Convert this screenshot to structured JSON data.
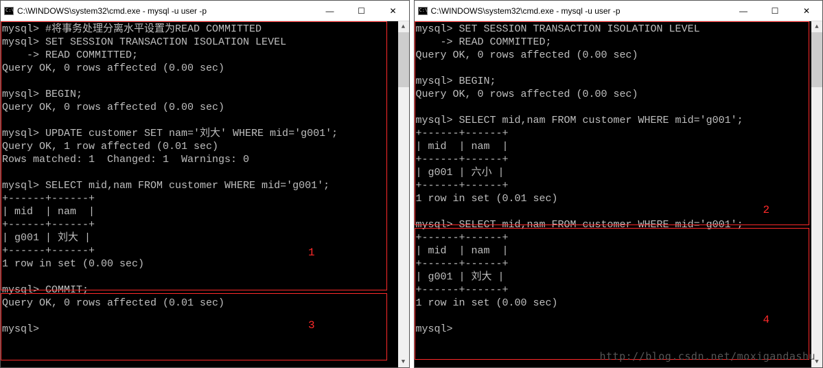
{
  "left": {
    "title": "C:\\WINDOWS\\system32\\cmd.exe - mysql  -u user -p",
    "lines": [
      "mysql> #将事务处理分离水平设置为READ COMMITTED",
      "mysql> SET SESSION TRANSACTION ISOLATION LEVEL",
      "    -> READ COMMITTED;",
      "Query OK, 0 rows affected (0.00 sec)",
      "",
      "mysql> BEGIN;",
      "Query OK, 0 rows affected (0.00 sec)",
      "",
      "mysql> UPDATE customer SET nam='刘大' WHERE mid='g001';",
      "Query OK, 1 row affected (0.01 sec)",
      "Rows matched: 1  Changed: 1  Warnings: 0",
      "",
      "mysql> SELECT mid,nam FROM customer WHERE mid='g001';",
      "+------+------+",
      "| mid  | nam  |",
      "+------+------+",
      "| g001 | 刘大 |",
      "+------+------+",
      "1 row in set (0.00 sec)",
      "",
      "mysql> COMMIT;",
      "Query OK, 0 rows affected (0.01 sec)",
      "",
      "mysql>"
    ],
    "box1_label": "1",
    "box3_label": "3"
  },
  "right": {
    "title": "C:\\WINDOWS\\system32\\cmd.exe - mysql  -u user -p",
    "lines": [
      "mysql> SET SESSION TRANSACTION ISOLATION LEVEL",
      "    -> READ COMMITTED;",
      "Query OK, 0 rows affected (0.00 sec)",
      "",
      "mysql> BEGIN;",
      "Query OK, 0 rows affected (0.00 sec)",
      "",
      "mysql> SELECT mid,nam FROM customer WHERE mid='g001';",
      "+------+------+",
      "| mid  | nam  |",
      "+------+------+",
      "| g001 | 六小 |",
      "+------+------+",
      "1 row in set (0.01 sec)",
      "",
      "mysql> SELECT mid,nam FROM customer WHERE mid='g001';",
      "+------+------+",
      "| mid  | nam  |",
      "+------+------+",
      "| g001 | 刘大 |",
      "+------+------+",
      "1 row in set (0.00 sec)",
      "",
      "mysql>"
    ],
    "box2_label": "2",
    "box4_label": "4"
  },
  "watermark": "http://blog.csdn.net/moxigandashu",
  "winbtns": {
    "min": "—",
    "max": "☐",
    "close": "✕"
  }
}
